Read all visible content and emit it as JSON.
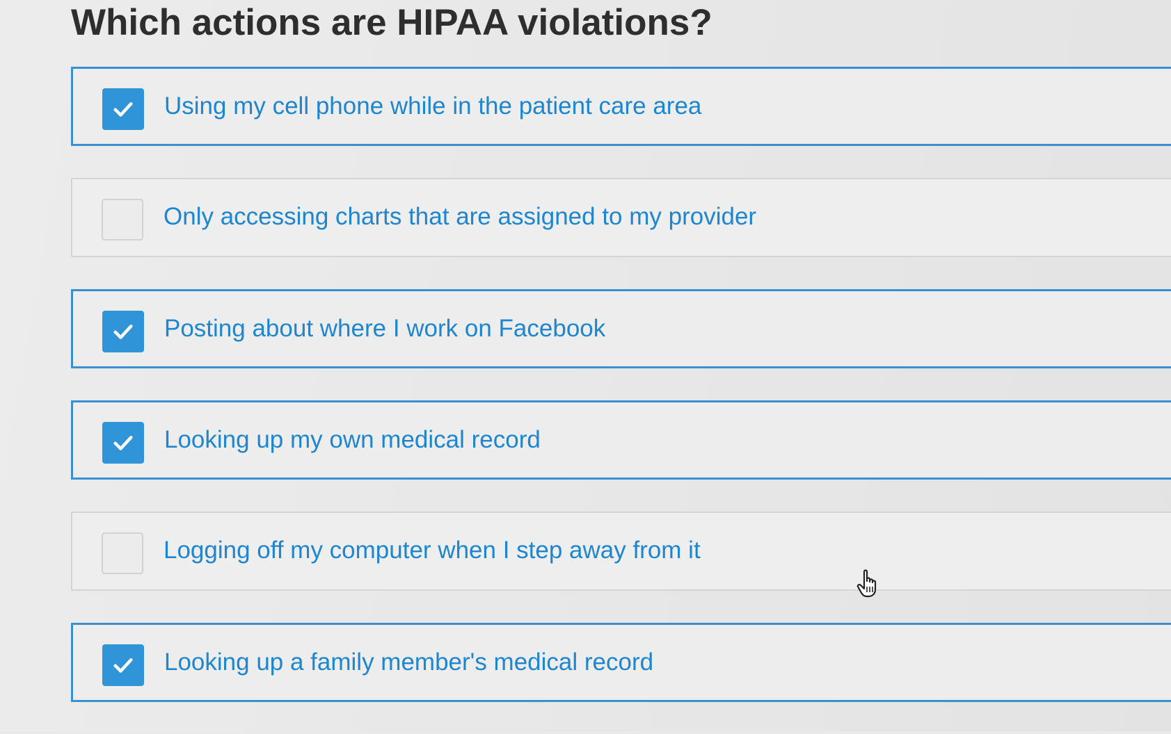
{
  "question": {
    "title": "Which actions are HIPAA violations?"
  },
  "options": [
    {
      "label": "Using my cell phone while in the patient care area",
      "checked": true
    },
    {
      "label": "Only accessing charts that are assigned to my provider",
      "checked": false
    },
    {
      "label": "Posting about where I work on Facebook",
      "checked": true
    },
    {
      "label": "Looking up my own medical record",
      "checked": true
    },
    {
      "label": "Logging off my computer when I step away from it",
      "checked": false
    },
    {
      "label": "Looking up a family member's medical record",
      "checked": true
    }
  ],
  "colors": {
    "accent": "#2f95d8",
    "label_text": "#1d86cf",
    "title_text": "#2e2e2e"
  },
  "icons": {
    "check": "check-icon",
    "cursor": "hand-pointer-cursor-icon"
  }
}
